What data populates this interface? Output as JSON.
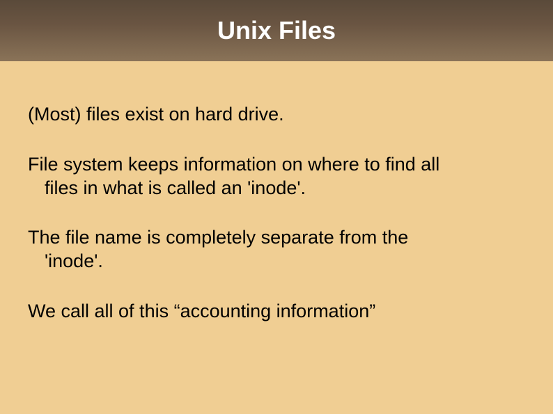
{
  "slide": {
    "title": "Unix Files",
    "para1": "(Most) files exist on hard drive.",
    "para2_line1": "File system keeps information on where to find all",
    "para2_line2": "files in what is called an 'inode'.",
    "para3_line1": "The file name is completely separate from the",
    "para3_line2": "'inode'.",
    "para4": "We call all of this “accounting information”"
  }
}
